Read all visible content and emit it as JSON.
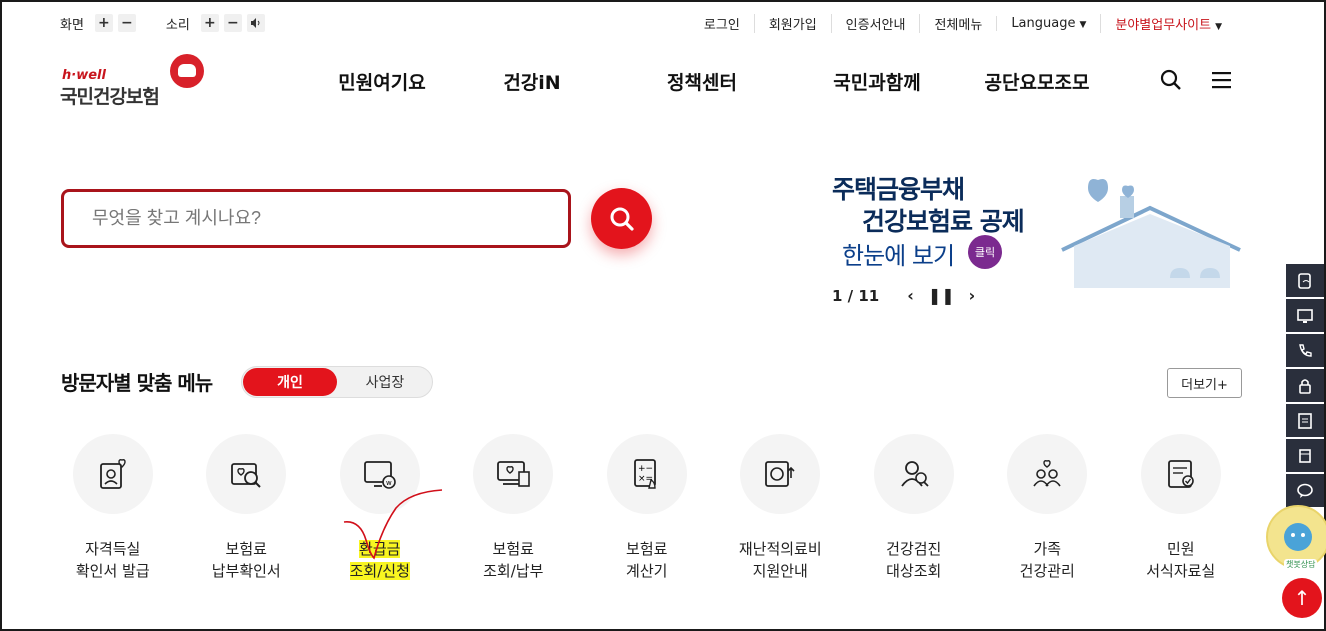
{
  "util": {
    "screen_label": "화면",
    "sound_label": "소리",
    "plus": "+",
    "minus": "−",
    "links": [
      "로그인",
      "회원가입",
      "인증서안내",
      "전체메뉴"
    ],
    "language": "Language",
    "field_site": "분야별업무사이트"
  },
  "logo": {
    "small": "h·well",
    "main": "국민건강보험"
  },
  "gnb": [
    "민원여기요",
    "건강iN",
    "정책센터",
    "국민과함께",
    "공단요모조모"
  ],
  "search": {
    "placeholder": "무엇을 찾고 계시나요?"
  },
  "banner": {
    "line1": "주택금융부채",
    "line2": "건강보험료 공제",
    "line3": "한눈에 보기",
    "click_badge": "클릭",
    "page": "1 / 11"
  },
  "visitor": {
    "title": "방문자별 맞춤 메뉴",
    "tab_personal": "개인",
    "tab_business": "사업장",
    "more": "더보기+"
  },
  "menu": [
    {
      "icon": "qualification-card-icon",
      "l1": "자격득실",
      "l2": "확인서 발급"
    },
    {
      "icon": "premium-search-icon",
      "l1": "보험료",
      "l2": "납부확인서"
    },
    {
      "icon": "refund-monitor-icon",
      "l1": "환급금",
      "l2": "조회/신청"
    },
    {
      "icon": "premium-pay-icon",
      "l1": "보험료",
      "l2": "조회/납부"
    },
    {
      "icon": "calculator-icon",
      "l1": "보험료",
      "l2": "계산기"
    },
    {
      "icon": "disaster-medical-icon",
      "l1": "재난적의료비",
      "l2": "지원안내"
    },
    {
      "icon": "health-checkup-icon",
      "l1": "건강검진",
      "l2": "대상조회"
    },
    {
      "icon": "family-health-icon",
      "l1": "가족",
      "l2": "건강관리"
    },
    {
      "icon": "form-library-icon",
      "l1": "민원",
      "l2": "서식자료실"
    }
  ],
  "mascot": {
    "tag": "챗봇상담"
  },
  "colors": {
    "brand_red": "#e3141c",
    "dark_red": "#a9141b",
    "navy": "#0b2c5a",
    "quick_bg": "#2a2f3c",
    "highlight": "#f8f521"
  }
}
